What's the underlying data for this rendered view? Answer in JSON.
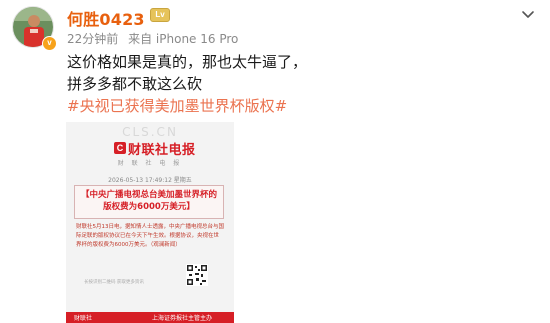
{
  "user": {
    "name": "何胜0423",
    "avatar_icon": "avatar-photo-red-jersey",
    "verified_badge": "v",
    "level_badge_color": "#e6c35a"
  },
  "meta": {
    "time": "22分钟前",
    "source": "来自 iPhone 16 Pro"
  },
  "post": {
    "lines": [
      "这价格如果是真的，那也太牛逼了，",
      "拼多多都不敢这么砍"
    ],
    "hashtag": "#央视已获得美加墨世界杯版权#"
  },
  "image": {
    "watermark": "CLS.CN",
    "logo_letter": "C",
    "brand": "财联社电报",
    "subtitle": "财 联 社 电 报",
    "date": "2026-05-13 17:49:12 星期五",
    "headline": "【中央广播电视总台美加墨世界杯的版权费为6000万美元】",
    "body": "财联社5月13日电，据知情人士透露，中央广播电视总台与国际足联的版权协议已在今天下午生效。根据协议，央视在世界杯的版权费为6000万美元。（观澜新闻）",
    "footer_small": "长按识别二维码 获取更多资讯",
    "bottom_left": "财联社",
    "bottom_right": "上海证券报社主管主办"
  },
  "colors": {
    "username": "#e8600e",
    "hashtag": "#eb7350",
    "brand_red": "#d61f26"
  }
}
